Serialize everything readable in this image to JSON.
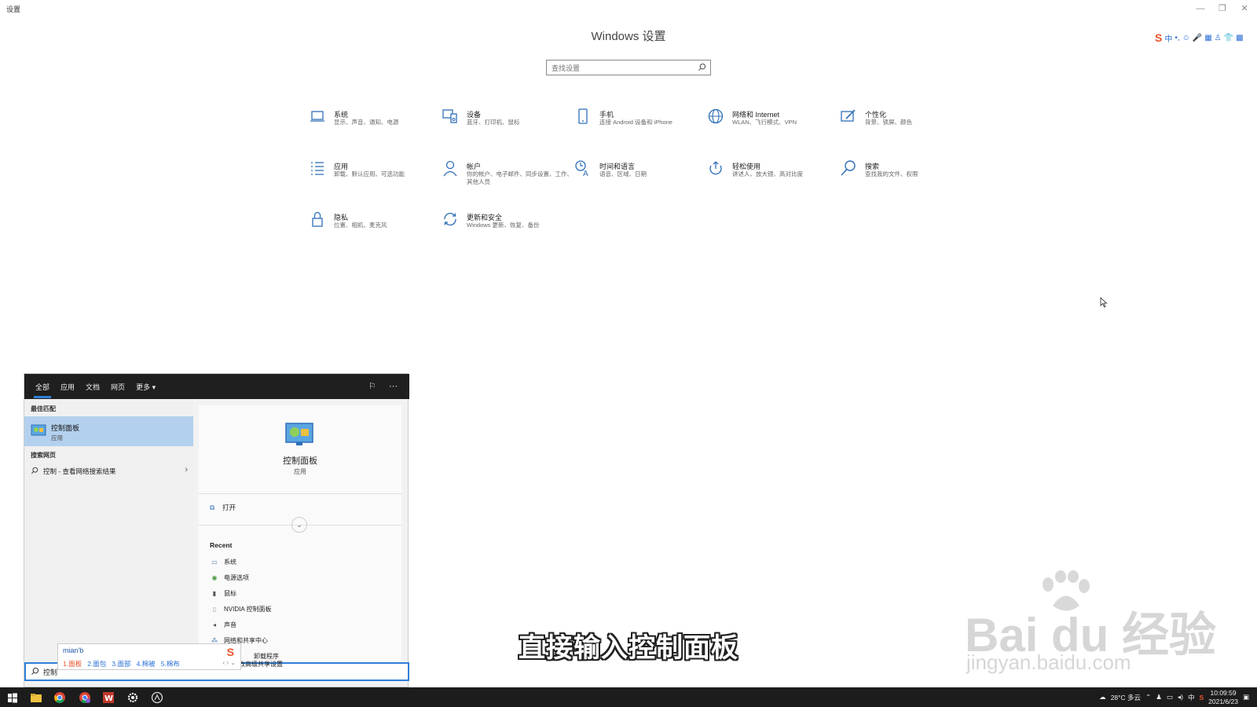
{
  "window": {
    "app_title": "设置",
    "settings_title": "Windows 设置",
    "search_placeholder": "查找设置",
    "minimize": "—",
    "restore": "❐",
    "close": "✕"
  },
  "ime_toolbar": [
    "S",
    "中",
    "•,",
    "☺",
    "🎤",
    "▦",
    "♙",
    "👕",
    "▩"
  ],
  "tiles": [
    {
      "name": "系统",
      "desc": "显示、声音、通知、电源",
      "icon": "laptop-icon"
    },
    {
      "name": "设备",
      "desc": "蓝牙、打印机、鼠标",
      "icon": "devices-icon"
    },
    {
      "name": "手机",
      "desc": "连接 Android 设备和 iPhone",
      "icon": "phone-icon"
    },
    {
      "name": "网络和 Internet",
      "desc": "WLAN、飞行模式、VPN",
      "icon": "globe-icon"
    },
    {
      "name": "个性化",
      "desc": "背景、锁屏、颜色",
      "icon": "personalize-icon"
    },
    {
      "name": "应用",
      "desc": "卸载、默认应用、可选功能",
      "icon": "apps-icon"
    },
    {
      "name": "帐户",
      "desc": "你的帐户、电子邮件、同步设置、工作、其他人员",
      "icon": "person-icon"
    },
    {
      "name": "时间和语言",
      "desc": "语音、区域、日期",
      "icon": "time-language-icon"
    },
    {
      "name": "轻松使用",
      "desc": "讲述人、放大镜、高对比度",
      "icon": "ease-of-access-icon"
    },
    {
      "name": "搜索",
      "desc": "查找我的文件、权限",
      "icon": "search-icon"
    },
    {
      "name": "隐私",
      "desc": "位置、相机、麦克风",
      "icon": "lock-icon"
    },
    {
      "name": "更新和安全",
      "desc": "Windows 更新、恢复、备份",
      "icon": "sync-icon"
    }
  ],
  "search_panel": {
    "tabs": [
      "全部",
      "应用",
      "文档",
      "网页",
      "更多 ▾"
    ],
    "best_match_header": "最佳匹配",
    "best_match": {
      "name": "控制面板",
      "type": "应用"
    },
    "web_header": "搜索网页",
    "web_item": "控制 - 查看网络搜索结果",
    "detail": {
      "title": "控制面板",
      "subtitle": "应用",
      "open": "打开"
    },
    "recent_header": "Recent",
    "recent": [
      "系统",
      "电源选项",
      "鼠标",
      "NVIDIA 控制面板",
      "声音",
      "网络和共享中心",
      "卸载程序",
      "更改高级共享设置"
    ],
    "query": "控制"
  },
  "ime_candidates": {
    "pinyin": "mian'b",
    "items": [
      "1.面板",
      "2.面包",
      "3.面部",
      "4.棉被",
      "5.棉布"
    ],
    "nav": "‹ › ⌄"
  },
  "subtitle": "直接输入控制面板",
  "watermark": {
    "main": "Bai du 经验",
    "sub": "jingyan.baidu.com"
  },
  "taskbar": {
    "weather": "28°C 多云",
    "ime": "中",
    "time": "10:09:59",
    "date": "2021/6/23"
  },
  "colors": {
    "accent": "#2f7fd8",
    "icon_blue": "#2f6fb8",
    "selected_bg": "#b3d1ee",
    "taskbar": "#1c1c1c"
  }
}
